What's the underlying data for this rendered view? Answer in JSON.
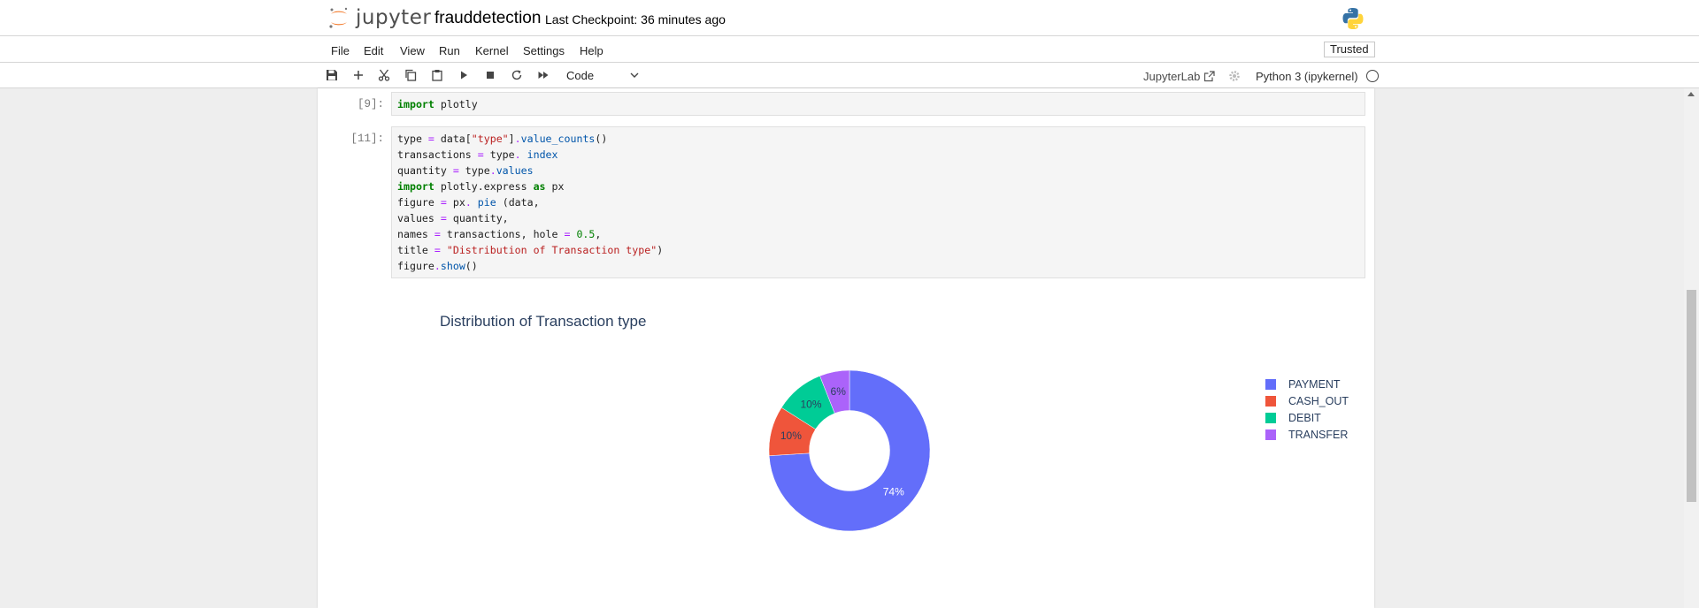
{
  "header": {
    "logo_text": "jupyter",
    "notebook_name": "frauddetection",
    "checkpoint": "Last Checkpoint: 36 minutes ago"
  },
  "menu": {
    "items": [
      "File",
      "Edit",
      "View",
      "Run",
      "Kernel",
      "Settings",
      "Help"
    ],
    "trusted": "Trusted"
  },
  "toolbar": {
    "buttons": [
      "save-icon",
      "add-cell-icon",
      "cut-icon",
      "copy-icon",
      "paste-icon",
      "run-icon",
      "stop-icon",
      "restart-icon",
      "fast-forward-icon"
    ],
    "cell_type": "Code",
    "jupyterlab_link": "JupyterLab",
    "kernel": "Python 3 (ipykernel)"
  },
  "cells": [
    {
      "prompt": "[9]:",
      "code": "import plotly"
    },
    {
      "prompt": "[11]:",
      "code": "type = data[\"type\"].value_counts()\ntransactions = type. index\nquantity = type.values\nimport plotly.express as px\nfigure = px. pie (data,\nvalues = quantity,\nnames = transactions, hole = 0.5,\ntitle = \"Distribution of Transaction type\")\nfigure.show()"
    }
  ],
  "chart_data": {
    "type": "pie",
    "title": "Distribution of Transaction type",
    "hole": 0.5,
    "categories": [
      "PAYMENT",
      "CASH_OUT",
      "DEBIT",
      "TRANSFER"
    ],
    "values": [
      74,
      10,
      10,
      6
    ],
    "labels": [
      "74%",
      "10%",
      "10%",
      "6%"
    ],
    "colors": [
      "#636efa",
      "#ef553b",
      "#00cc96",
      "#ab63fa"
    ],
    "legend_position": "right"
  },
  "colors": {
    "jupyter_orange": "#f37726",
    "plot_text": "#2a3f5f"
  }
}
